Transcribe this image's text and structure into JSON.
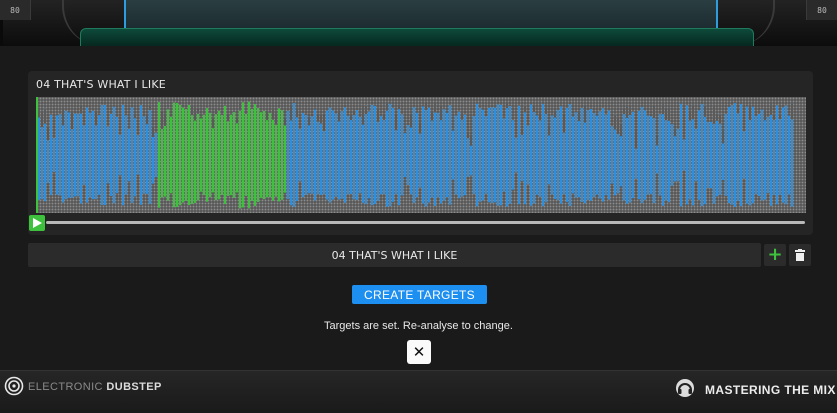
{
  "header": {
    "meter_left_value": "80",
    "meter_right_value": "80"
  },
  "waveform": {
    "track_title": "04 THAT'S WHAT I LIKE",
    "playhead_fraction": 0.0,
    "colors": {
      "background_dots": "#8c8c8c",
      "waveform": "#2d8fde",
      "highlight": "#3ec23e",
      "playhead": "#3ec23e"
    }
  },
  "track_list": {
    "items": [
      {
        "label": "04 THAT'S WHAT I LIKE"
      }
    ],
    "add_icon": "plus-icon",
    "delete_icon": "trash-icon"
  },
  "actions": {
    "create_targets_label": "CREATE TARGETS",
    "status_text": "Targets are set. Re-analyse to change.",
    "close_icon": "close-icon"
  },
  "footer": {
    "genre_prefix": "ELECTRONIC",
    "genre_name": "DUBSTEP",
    "brand_name": "MASTERING THE MIX",
    "colors": {
      "accent": "#1d8ff0",
      "play": "#3ec23e"
    }
  }
}
